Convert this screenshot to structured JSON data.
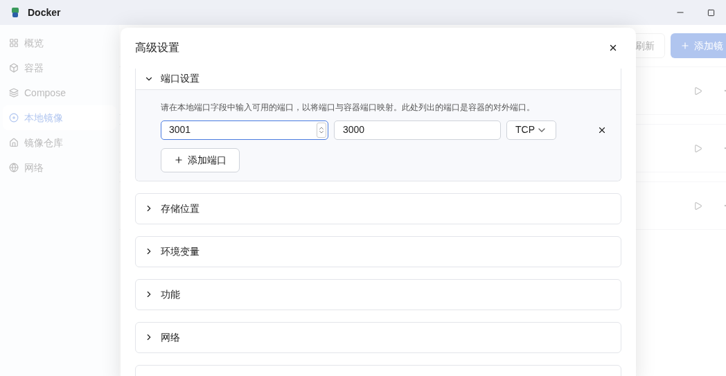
{
  "window": {
    "title": "Docker"
  },
  "sidebar": {
    "items": [
      {
        "label": "概览",
        "selected": false
      },
      {
        "label": "容器",
        "selected": false
      },
      {
        "label": "Compose",
        "selected": false
      },
      {
        "label": "本地镜像",
        "selected": true
      },
      {
        "label": "镜像仓库",
        "selected": false
      },
      {
        "label": "网络",
        "selected": false
      }
    ]
  },
  "toolbar": {
    "buttons": [
      {
        "label": "刷新",
        "kind": "secondary"
      },
      {
        "label": "添加镜",
        "kind": "primary"
      }
    ]
  },
  "dialog": {
    "title": "高级设置",
    "sections": [
      {
        "title": "端口设置",
        "expanded": true,
        "description": "请在本地端口字段中输入可用的端口，以将端口与容器端口映射。此处列出的端口是容器的对外端口。",
        "ports": [
          {
            "host_port": "3001",
            "container_port": "3000",
            "protocol": "TCP",
            "focused": true
          }
        ],
        "add_button": "添加端口"
      },
      {
        "title": "存储位置",
        "expanded": false
      },
      {
        "title": "环境变量",
        "expanded": false
      },
      {
        "title": "功能",
        "expanded": false
      },
      {
        "title": "网络",
        "expanded": false
      }
    ]
  }
}
